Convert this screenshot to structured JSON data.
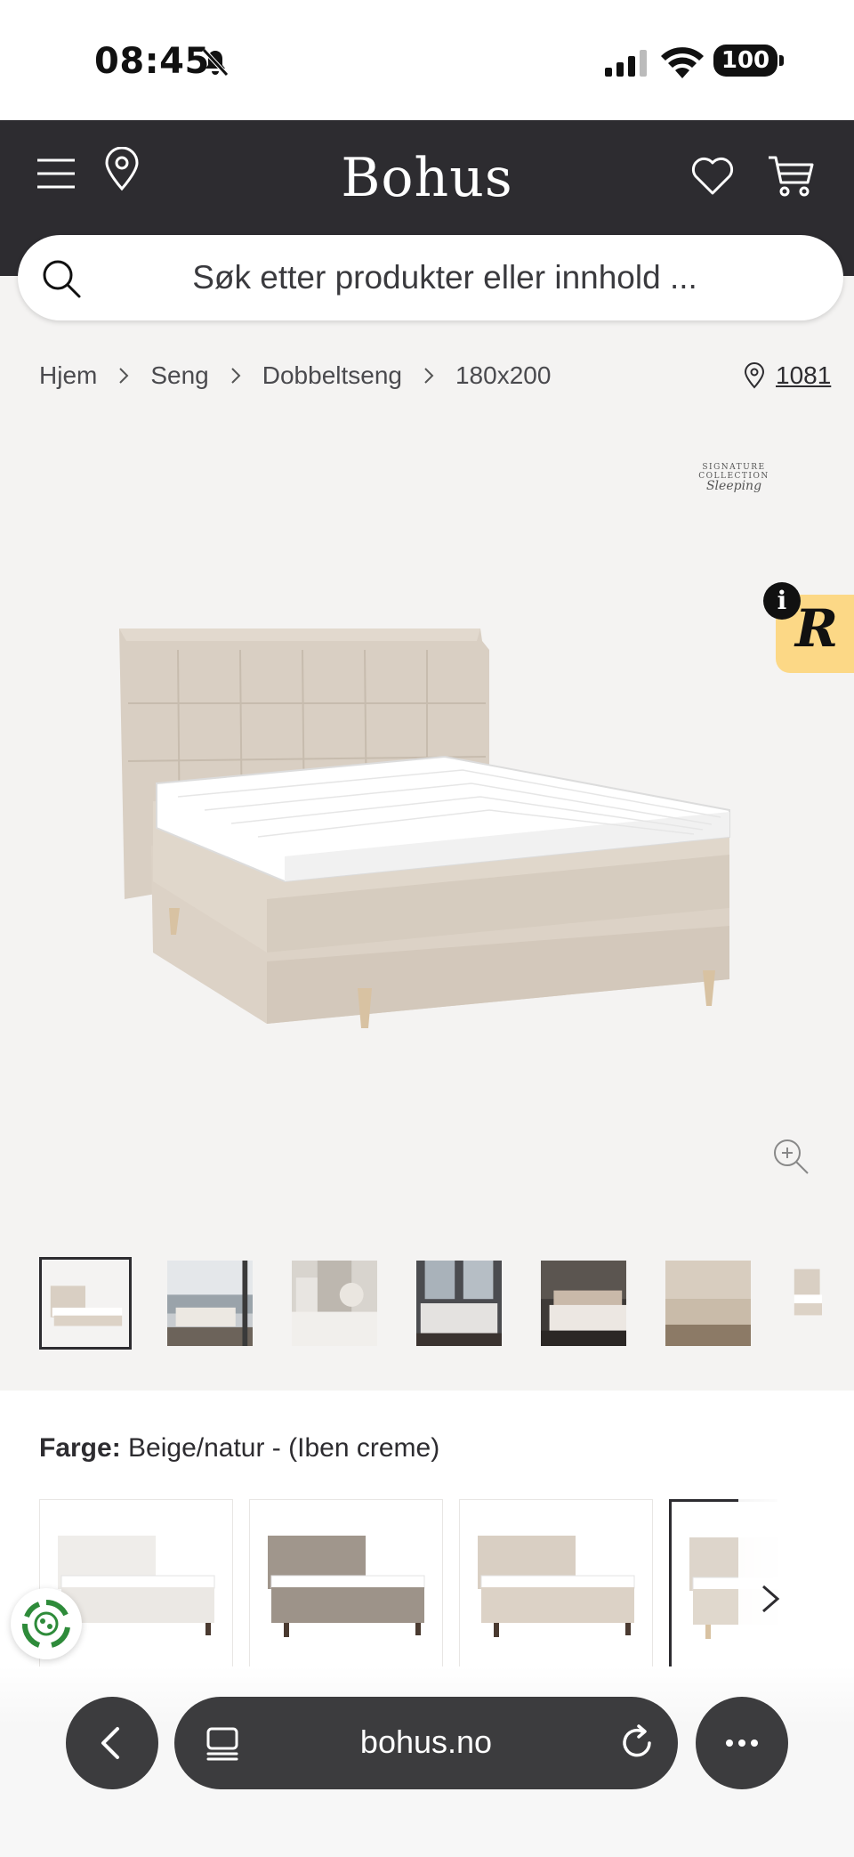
{
  "status_bar": {
    "time": "08:45",
    "battery": "100",
    "icons": [
      "bell-slash-icon",
      "signal-icon",
      "wifi-icon",
      "battery-icon"
    ]
  },
  "header": {
    "logo": "Bohus",
    "icons": [
      "menu-icon",
      "location-pin-icon",
      "heart-icon",
      "cart-icon"
    ],
    "background": "#2d2c30"
  },
  "search": {
    "placeholder": "Søk etter produkter eller innhold ..."
  },
  "breadcrumb": {
    "items": [
      "Hjem",
      "Seng",
      "Dobbeltseng",
      "180x200"
    ],
    "store_number": "1081"
  },
  "product_image": {
    "brand_badge_line1": "SIGNATURE COLLECTION",
    "brand_badge_line2": "Sleeping",
    "review_badge_letter": "R",
    "review_badge_info": "i"
  },
  "thumbnails": {
    "count_visible": 7,
    "active_index": 0
  },
  "color_selector": {
    "label": "Farge:",
    "value": "Beige/natur - (Iben creme)",
    "selected_index": 3
  },
  "browser_bar": {
    "url": "bohus.no",
    "icons": [
      "back-chevron-icon",
      "tabs-icon",
      "reload-icon",
      "more-icon"
    ]
  },
  "colors": {
    "header_bg": "#2d2c30",
    "gallery_bg": "#f4f3f2",
    "review_badge": "#fcd886",
    "browser_controls": "#3c3c3e"
  }
}
